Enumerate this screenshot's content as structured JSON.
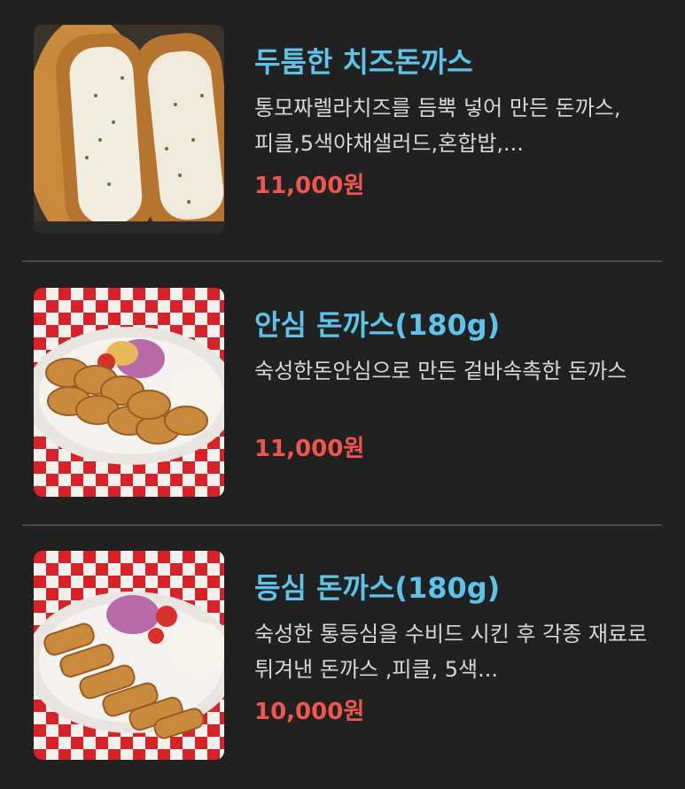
{
  "colors": {
    "background": "#212121",
    "name": "#5ec3e8",
    "price": "#f0564f",
    "description": "#d6d6d6",
    "divider": "#4a4a4a"
  },
  "menu": [
    {
      "name": "두툼한 치즈돈까스",
      "description": "통모짜렐라치즈를 듬뿍 넣어 만든 돈까스,피클,5색야채샐러드,혼합밥,...",
      "price": "11,000원",
      "image": "cheese-tonkatsu-photo"
    },
    {
      "name": "안심 돈까스(180g)",
      "description": "숙성한돈안심으로 만든 겉바속촉한 돈까스",
      "price": "11,000원",
      "image": "tenderloin-tonkatsu-photo"
    },
    {
      "name": "등심 돈까스(180g)",
      "description": "숙성한 통등심을 수비드 시킨 후 각종 재료로 튀겨낸 돈까스 ,피클, 5색...",
      "price": "10,000원",
      "image": "sirloin-tonkatsu-photo"
    }
  ]
}
